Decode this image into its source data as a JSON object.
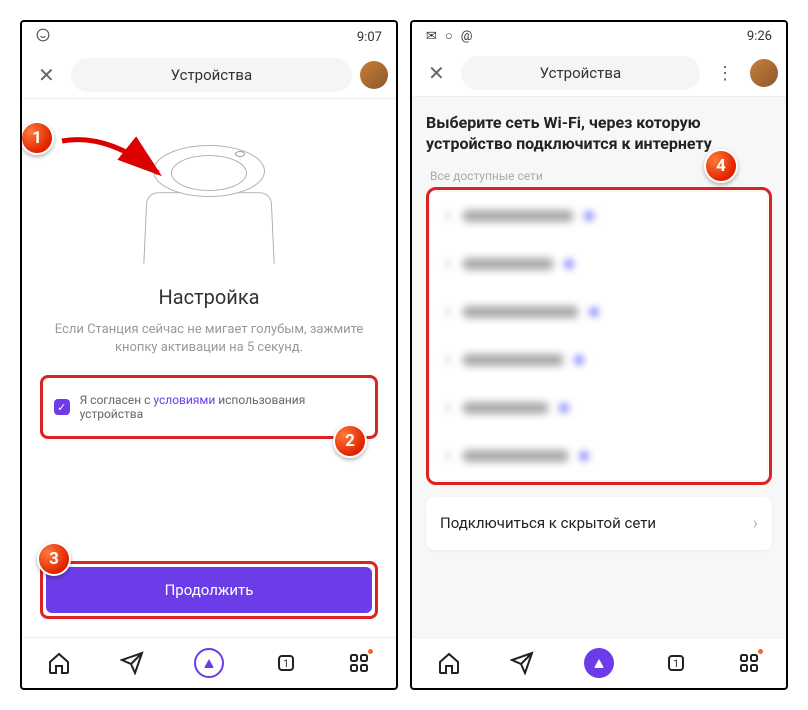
{
  "left": {
    "status": {
      "time": "9:07"
    },
    "header": {
      "title": "Устройства"
    },
    "title": "Настройка",
    "description": "Если Станция сейчас не мигает голубым, зажмите кнопку активации на 5 секунд.",
    "terms": {
      "pre": "Я согласен с ",
      "link": "условиями",
      "post": " использования устройства"
    },
    "continue": "Продолжить"
  },
  "right": {
    "status": {
      "time": "9:26"
    },
    "header": {
      "title": "Устройства"
    },
    "wifiTitle": "Выберите сеть Wi-Fi, через которую устройство подключится к интернету",
    "allNetworks": "Все доступные сети",
    "hidden": "Подключиться к скрытой сети"
  },
  "callouts": {
    "c1": "1",
    "c2": "2",
    "c3": "3",
    "c4": "4"
  },
  "wifiWidths": [
    "110px",
    "90px",
    "115px",
    "100px",
    "85px",
    "105px"
  ]
}
